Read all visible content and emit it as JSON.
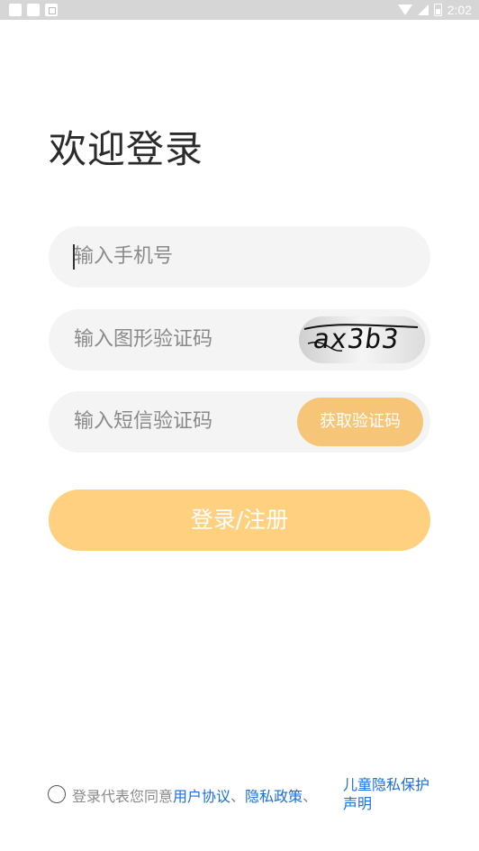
{
  "status_bar": {
    "time": "2:02"
  },
  "title": "欢迎登录",
  "phone": {
    "placeholder": "输入手机号"
  },
  "captcha": {
    "placeholder": "输入图形验证码",
    "image_text": "ax3b3"
  },
  "sms": {
    "placeholder": "输入短信验证码",
    "get_code_label": "获取验证码"
  },
  "login_button": "登录/注册",
  "agreement": {
    "prefix": "登录代表您同意",
    "user_agreement": "用户协议",
    "sep1": "、",
    "privacy_policy": "隐私政策",
    "sep2": "、",
    "children_privacy": "儿童隐私保护声明"
  },
  "colors": {
    "accent": "#ffd080",
    "code_button": "#f6c577",
    "link": "#1a6ee0",
    "field_bg": "#f4f4f4"
  }
}
